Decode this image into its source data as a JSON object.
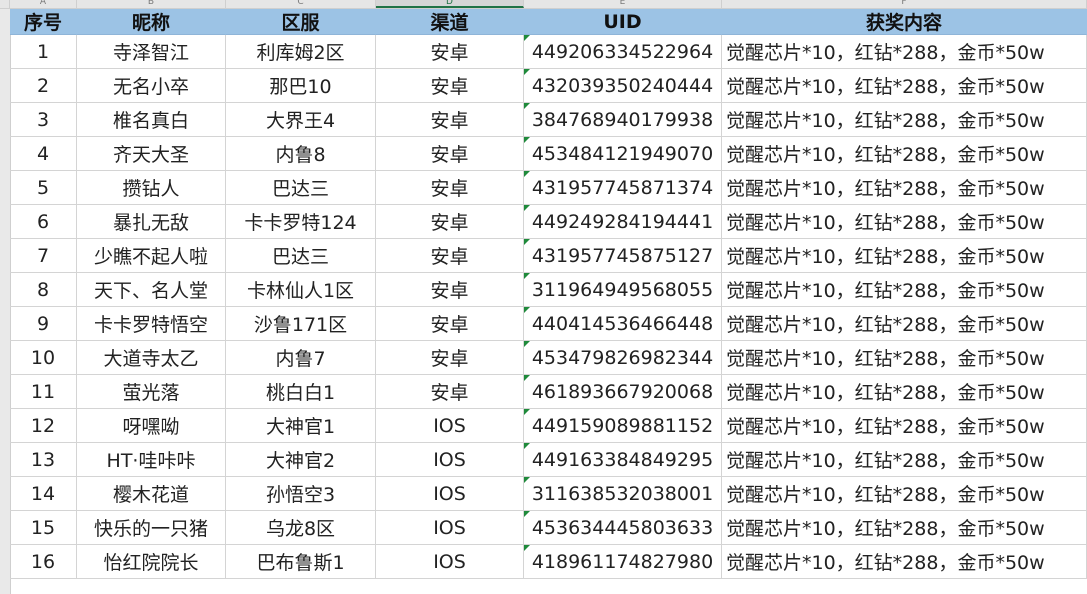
{
  "columns": [
    "A",
    "B",
    "C",
    "D",
    "E",
    "F"
  ],
  "table": {
    "headers": [
      "序号",
      "昵称",
      "区服",
      "渠道",
      "UID",
      "获奖内容"
    ],
    "rows": [
      [
        "1",
        "寺泽智江",
        "利库姆2区",
        "安卓",
        "449206334522964",
        "觉醒芯片*10，红钻*288，金币*50w"
      ],
      [
        "2",
        "无名小卒",
        "那巴10",
        "安卓",
        "432039350240444",
        "觉醒芯片*10，红钻*288，金币*50w"
      ],
      [
        "3",
        "椎名真白",
        "大界王4",
        "安卓",
        "384768940179938",
        "觉醒芯片*10，红钻*288，金币*50w"
      ],
      [
        "4",
        "齐天大圣",
        "内鲁8",
        "安卓",
        "453484121949070",
        "觉醒芯片*10，红钻*288，金币*50w"
      ],
      [
        "5",
        "攒钻人",
        "巴达三",
        "安卓",
        "431957745871374",
        "觉醒芯片*10，红钻*288，金币*50w"
      ],
      [
        "6",
        "暴扎无敌",
        "卡卡罗特124",
        "安卓",
        "449249284194441",
        "觉醒芯片*10，红钻*288，金币*50w"
      ],
      [
        "7",
        "少瞧不起人啦",
        "巴达三",
        "安卓",
        "431957745875127",
        "觉醒芯片*10，红钻*288，金币*50w"
      ],
      [
        "8",
        "天下、名人堂",
        "卡林仙人1区",
        "安卓",
        "311964949568055",
        "觉醒芯片*10，红钻*288，金币*50w"
      ],
      [
        "9",
        "卡卡罗特悟空",
        "沙鲁171区",
        "安卓",
        "440414536466448",
        "觉醒芯片*10，红钻*288，金币*50w"
      ],
      [
        "10",
        "大道寺太乙",
        "内鲁7",
        "安卓",
        "453479826982344",
        "觉醒芯片*10，红钻*288，金币*50w"
      ],
      [
        "11",
        "萤光落",
        "桃白白1",
        "安卓",
        "461893667920068",
        "觉醒芯片*10，红钻*288，金币*50w"
      ],
      [
        "12",
        "呀嘿呦",
        "大神官1",
        "IOS",
        "449159089881152",
        "觉醒芯片*10，红钻*288，金币*50w"
      ],
      [
        "13",
        "HT·哇咔咔",
        "大神官2",
        "IOS",
        "449163384849295",
        "觉醒芯片*10，红钻*288，金币*50w"
      ],
      [
        "14",
        "樱木花道",
        "孙悟空3",
        "IOS",
        "311638532038001",
        "觉醒芯片*10，红钻*288，金币*50w"
      ],
      [
        "15",
        "快乐的一只猪",
        "乌龙8区",
        "IOS",
        "453634445803633",
        "觉醒芯片*10，红钻*288，金币*50w"
      ],
      [
        "16",
        "怡红院院长",
        "巴布鲁斯1",
        "IOS",
        "418961174827980",
        "觉醒芯片*10，红钻*288，金币*50w"
      ]
    ]
  },
  "colors": {
    "header_fill": "#9cc3e5",
    "gridline": "#d4d4d4",
    "selection_accent": "#217346"
  }
}
